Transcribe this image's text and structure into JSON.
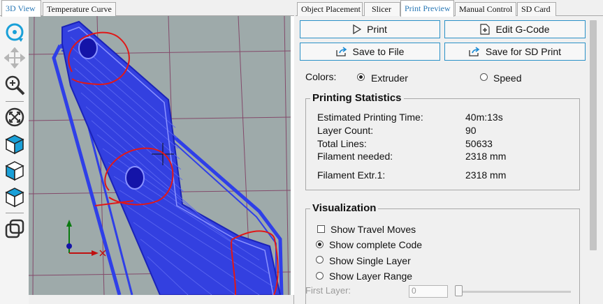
{
  "left_tabs": [
    {
      "label": "3D View",
      "active": true
    },
    {
      "label": "Temperature Curve",
      "active": false
    }
  ],
  "right_tabs": [
    {
      "label": "Object Placement",
      "active": false
    },
    {
      "label": "Slicer",
      "active": false
    },
    {
      "label": "Print Preview",
      "active": true
    },
    {
      "label": "Manual Control",
      "active": false
    },
    {
      "label": "SD Card",
      "active": false
    }
  ],
  "toolbar_icons": [
    "rotate-view-icon",
    "move-view-icon",
    "zoom-icon",
    "fit-view-icon",
    "isometric-view-icon",
    "front-view-icon",
    "top-view-icon",
    "toggle-display-icon"
  ],
  "buttons": {
    "print": "Print",
    "edit_gcode": "Edit G-Code",
    "save_to_file": "Save to File",
    "save_for_sd": "Save for SD Print"
  },
  "colors": {
    "label": "Colors:",
    "options": [
      {
        "label": "Extruder",
        "selected": true
      },
      {
        "label": "Speed",
        "selected": false
      }
    ]
  },
  "stats": {
    "title": "Printing Statistics",
    "rows": [
      {
        "label": "Estimated Printing Time:",
        "value": "40m:13s"
      },
      {
        "label": "Layer Count:",
        "value": "90"
      },
      {
        "label": "Total Lines:",
        "value": "50633"
      },
      {
        "label": "Filament needed:",
        "value": "2318 mm"
      },
      {
        "label": "Filament Extr.1:",
        "value": "2318 mm"
      }
    ]
  },
  "visualization": {
    "title": "Visualization",
    "show_travel_moves": {
      "label": "Show Travel Moves",
      "checked": false
    },
    "modes": [
      {
        "label": "Show complete Code",
        "selected": true
      },
      {
        "label": "Show Single Layer",
        "selected": false
      },
      {
        "label": "Show Layer Range",
        "selected": false
      }
    ],
    "first_layer_label": "First Layer:",
    "first_layer_value": "0"
  },
  "theme": {
    "accent": "#2a91c7",
    "active_tab_text": "#2a78b5",
    "viewport_bg": "#9eaaaa",
    "print_path": "#2f3fe8",
    "annotation": "#e01818"
  }
}
